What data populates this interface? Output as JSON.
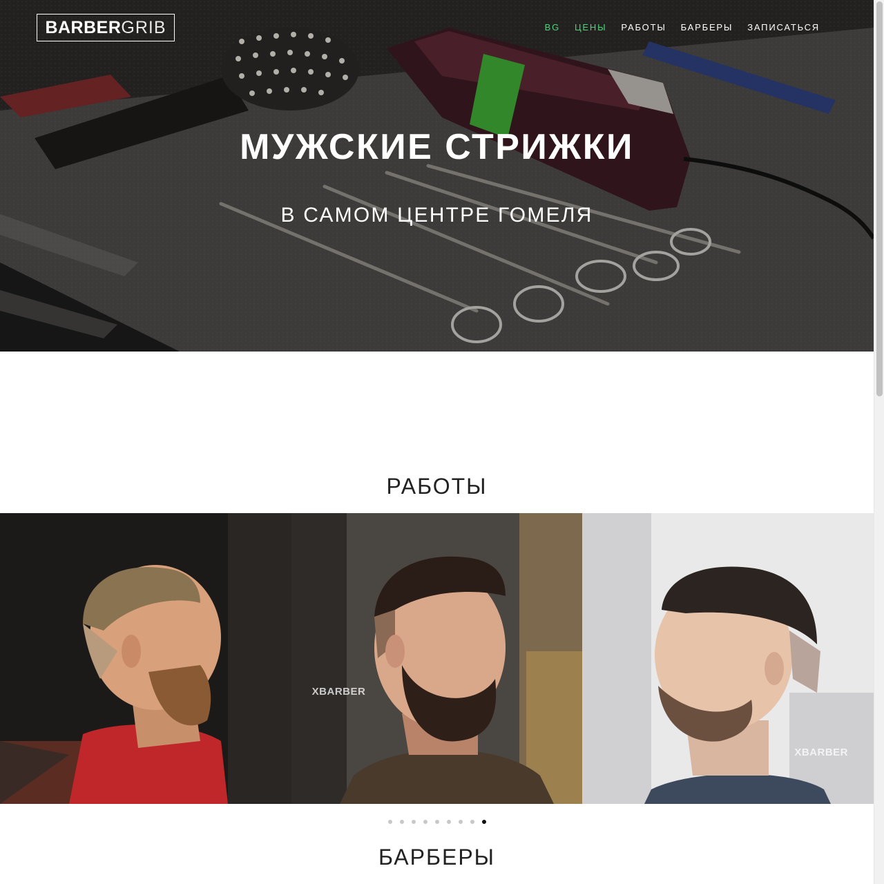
{
  "logo": {
    "bold": "BARBER",
    "thin": "GRIB"
  },
  "nav": [
    {
      "label": "BG",
      "active": true
    },
    {
      "label": "ЦЕНЫ",
      "active": true
    },
    {
      "label": "РАБОТЫ",
      "active": false
    },
    {
      "label": "БАРБЕРЫ",
      "active": false
    },
    {
      "label": "ЗАПИСАТЬСЯ",
      "active": false
    }
  ],
  "hero": {
    "title": "МУЖСКИЕ СТРИЖКИ",
    "subtitle": "В САМОМ ЦЕНТРЕ ГОМЕЛЯ"
  },
  "works": {
    "title": "РАБОТЫ",
    "watermarks": [
      "XBARBER",
      "XBARBER"
    ],
    "slides_total": 9,
    "active_slide": 9
  },
  "barbers": {
    "title": "БАРБЕРЫ"
  },
  "colors": {
    "nav_active": "#4cd37b",
    "dot_active": "#111111",
    "dot_inactive": "#c8c8c8"
  }
}
